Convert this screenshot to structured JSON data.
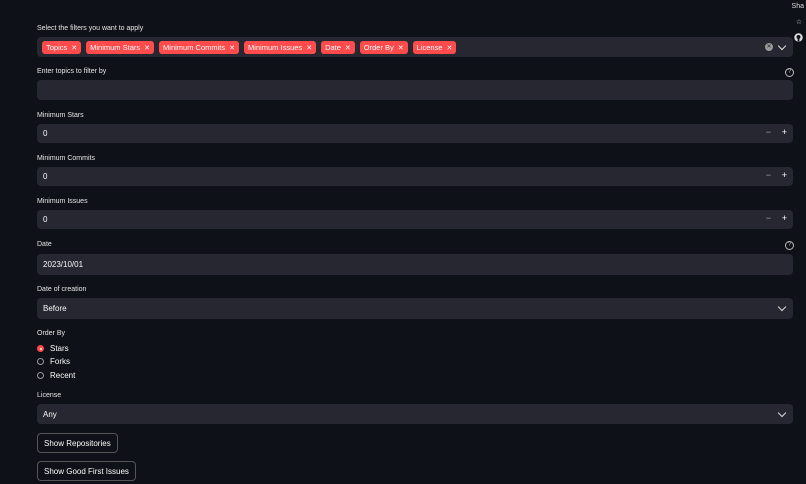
{
  "filters": {
    "label": "Select the filters you want to apply",
    "tags": [
      "Topics",
      "Minimum Stars",
      "Minimum Commits",
      "Minimum Issues",
      "Date",
      "Order By",
      "License"
    ]
  },
  "topics": {
    "label": "Enter topics to filter by",
    "value": ""
  },
  "min_stars": {
    "label": "Minimum Stars",
    "value": "0"
  },
  "min_commits": {
    "label": "Minimum Commits",
    "value": "0"
  },
  "min_issues": {
    "label": "Minimum Issues",
    "value": "0"
  },
  "date": {
    "label": "Date",
    "value": "2023/10/01"
  },
  "date_of_creation": {
    "label": "Date of creation",
    "value": "Before"
  },
  "order_by": {
    "label": "Order By",
    "options": [
      "Stars",
      "Forks",
      "Recent"
    ],
    "selected": "Stars"
  },
  "license": {
    "label": "License",
    "value": "Any"
  },
  "buttons": {
    "show_repos": "Show Repositories",
    "show_good_first": "Show Good First Issues"
  },
  "sidebar": {
    "share": "Sha"
  },
  "icons": {
    "clear": "clear-icon",
    "chevron": "chevron-down-icon",
    "help": "help-icon",
    "star": "star-icon",
    "github": "github-icon"
  },
  "colors": {
    "accent": "#ff4b4b",
    "background": "#0e1117",
    "field": "#262730"
  }
}
